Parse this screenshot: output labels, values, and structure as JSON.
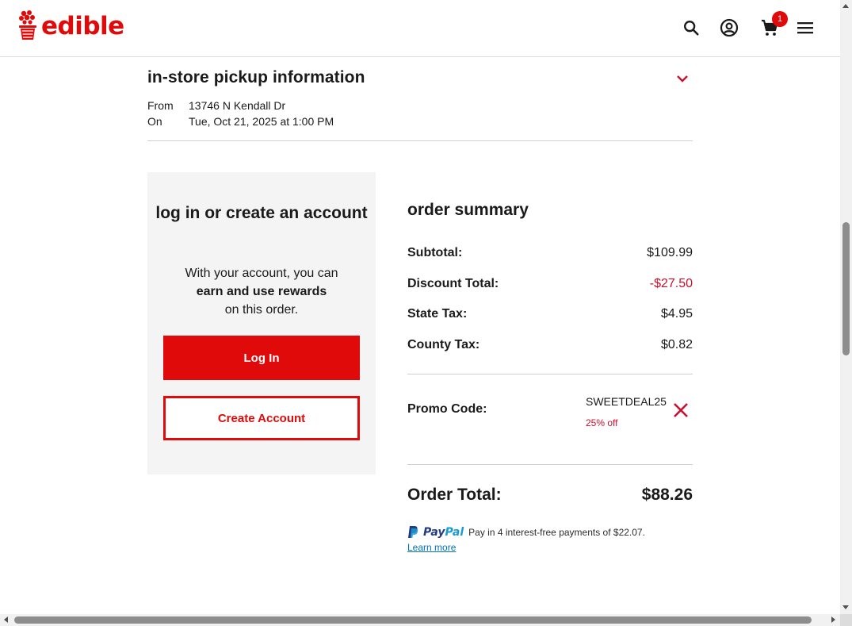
{
  "header": {
    "logo_text": "edible",
    "cart_count": "1",
    "icons": [
      "search-icon",
      "account-icon",
      "cart-icon",
      "menu-icon"
    ]
  },
  "pickup": {
    "title": "in-store pickup information",
    "from_label": "From",
    "from_value": "13746 N Kendall Dr",
    "on_label": "On",
    "on_value": "Tue, Oct 21, 2025 at 1:00 PM"
  },
  "login": {
    "title": "log in or create an account",
    "text_before": "With your account, you can",
    "text_bold": "earn and use rewards",
    "text_after": "on this order.",
    "login_button": "Log In",
    "create_button": "Create Account"
  },
  "summary": {
    "title": "order summary",
    "rows": [
      {
        "label": "Subtotal:",
        "value": "$109.99"
      },
      {
        "label": "Discount Total:",
        "value": "-$27.50"
      },
      {
        "label": "State Tax:",
        "value": "$4.95"
      },
      {
        "label": "County Tax:",
        "value": "$0.82"
      }
    ],
    "promo_label": "Promo Code:",
    "promo_code": "SWEETDEAL25",
    "promo_desc": "25% off",
    "total_label": "Order Total:",
    "total_value": "$88.26"
  },
  "paypal": {
    "brand_pay": "Pay",
    "brand_pal": "Pal",
    "message": "Pay in 4 interest-free payments of $22.07.",
    "link": "Learn more"
  },
  "colors": {
    "brand_red": "#e10a0a",
    "promo_red": "#c8102e",
    "paypal_dark": "#253b80",
    "paypal_light": "#179bd7",
    "link_blue": "#0070ba"
  }
}
